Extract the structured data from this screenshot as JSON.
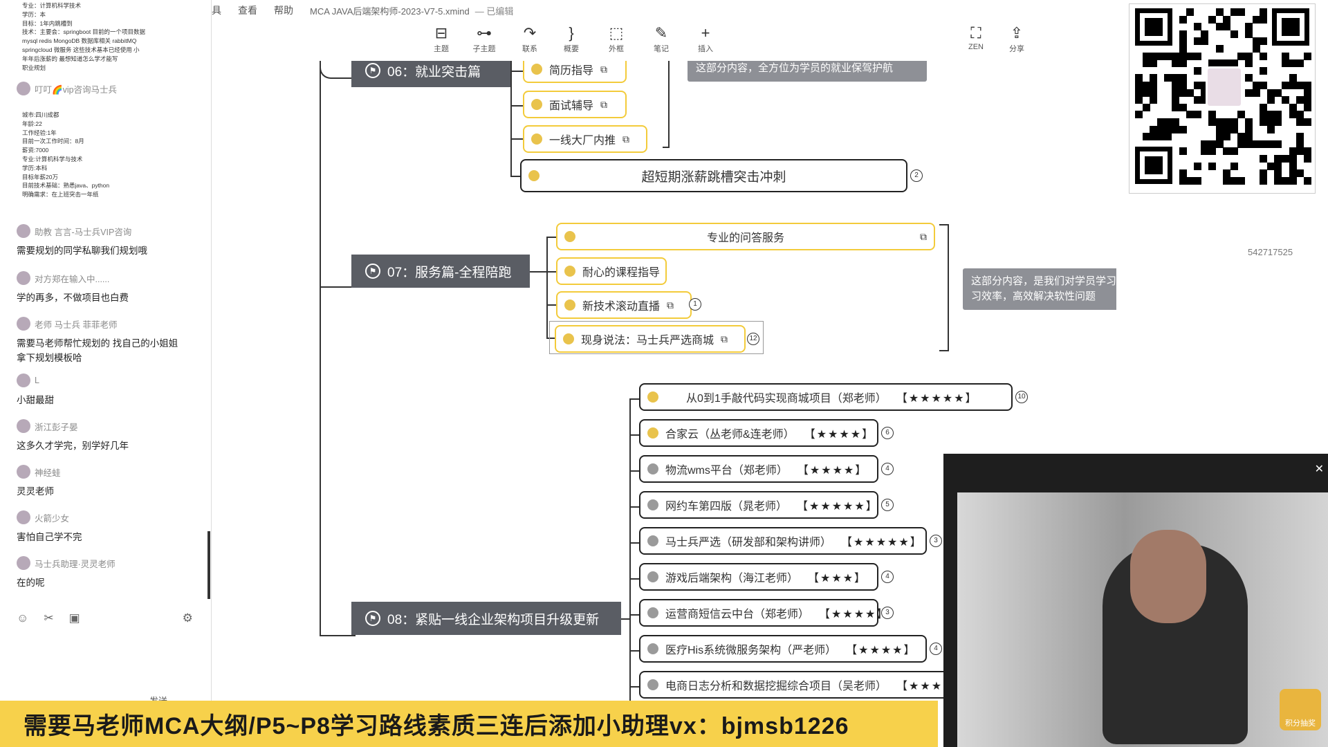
{
  "menu": {
    "items": [
      "具",
      "查看",
      "帮助"
    ],
    "doc_title": "MCA JAVA后端架构师-2023-V7-5.xmind",
    "doc_status": "— 已编辑"
  },
  "toolbar": {
    "items": [
      {
        "label": "主题",
        "icon": "topic-icon"
      },
      {
        "label": "子主题",
        "icon": "subtopic-icon"
      },
      {
        "label": "联系",
        "icon": "relationship-icon"
      },
      {
        "label": "概要",
        "icon": "summary-icon"
      },
      {
        "label": "外框",
        "icon": "boundary-icon"
      },
      {
        "label": "笔记",
        "icon": "note-icon"
      },
      {
        "label": "插入",
        "icon": "plus-icon"
      },
      {
        "label": "ZEN",
        "icon": "zen-icon"
      },
      {
        "label": "分享",
        "icon": "share-icon"
      }
    ]
  },
  "chat": {
    "block1": [
      "专业：计算机科学技术",
      "学历：本",
      "目标：1年内跳槽到",
      "技术：主要会：springboot 目前的一个项目数据",
      "mysql redis MongoDB 数据库相关 rabbitMQ",
      "springcloud 微服务 这些技术基本已经使用 小",
      "年年后涨薪的 最想知道怎么学才能写",
      "职业规划"
    ],
    "user1": "叮叮🌈vip咨询马士兵",
    "block2": [
      "城市:四川成都",
      "年龄:22",
      "工作经验:1年",
      "目前一次工作时间：8月",
      "薪资:7000",
      "专业:计算机科学与技术",
      "学历:本科",
      "目标年薪20万",
      "目前技术基础：熟悉java、python",
      "明确需求：在上班突击一年纸"
    ],
    "messages": [
      {
        "name": "助教  言言-马士兵VIP咨询",
        "text": "需要规划的同学私聊我们规划哦"
      },
      {
        "name": "对方郑在输入中......",
        "text": "学的再多，不做项目也白费"
      },
      {
        "name": "老师  马士兵  菲菲老师",
        "text": "需要马老师帮忙规划的 找自己的小姐姐 拿下规划模板哈"
      },
      {
        "name": "L",
        "text": "小甜最甜"
      },
      {
        "name": "浙江彭子晏",
        "text": "这多久才学完，别学好几年"
      },
      {
        "name": "神经蛙",
        "text": "灵灵老师"
      },
      {
        "name": "火箭少女",
        "text": "害怕自己学不完"
      },
      {
        "name": "马士兵助理·灵灵老师",
        "text": "在的呢"
      }
    ],
    "send_label": "发送"
  },
  "mindmap": {
    "sections": [
      {
        "label": "06：就业突击篇"
      },
      {
        "label": "07：服务篇-全程陪跑"
      },
      {
        "label": "08：紧贴一线企业架构项目升级更新"
      }
    ],
    "s06_nodes": [
      "简历指导",
      "面试辅导",
      "一线大厂内推",
      "超短期涨薪跳槽突击冲刺"
    ],
    "s06_note": "这部分内容，全方位为学员的就业保驾护航",
    "s06_badge": "2",
    "s07_nodes": [
      "专业的问答服务",
      "耐心的课程指导",
      "新技术滚动直播",
      "现身说法：马士兵严选商城"
    ],
    "s07_note": "这部分内容，是我们对学员学习过程的陪跑，提高学习效率，高效解决软性问题",
    "s07_badges": [
      "1",
      "12"
    ],
    "s08_projects": [
      {
        "name": "从0到1手敲代码实现商城项目（郑老师）",
        "stars": "【★★★★★】",
        "badge": "10"
      },
      {
        "name": "合家云（丛老师&连老师）",
        "stars": "【★★★★】",
        "badge": "6"
      },
      {
        "name": "物流wms平台（郑老师）",
        "stars": "【★★★★】",
        "badge": "4"
      },
      {
        "name": "网约车第四版（晁老师）",
        "stars": "【★★★★★】",
        "badge": "5"
      },
      {
        "name": "马士兵严选（研发部和架构讲师）",
        "stars": "【★★★★★】",
        "badge": "3"
      },
      {
        "name": "游戏后端架构（海江老师）",
        "stars": "【★★★】",
        "badge": "4"
      },
      {
        "name": "运营商短信云中台（郑老师）",
        "stars": "【★★★★】",
        "badge": "3"
      },
      {
        "name": "医疗His系统微服务架构（严老师）",
        "stars": "【★★★★】",
        "badge": "4"
      },
      {
        "name": "电商日志分析和数据挖掘综合项目（吴老师）",
        "stars": "【★★★",
        "badge": ""
      }
    ]
  },
  "overlay": {
    "uid": "542717525",
    "video_badge": "积分抽奖",
    "banner": "需要马老师MCA大纲/P5~P8学习路线素质三连后添加小助理vx：bjmsb1226"
  },
  "colors": {
    "accent": "#f3cb3a",
    "section_bg": "#5a5d64",
    "banner_bg": "#f7d14b",
    "note_bg": "#8e9096"
  }
}
